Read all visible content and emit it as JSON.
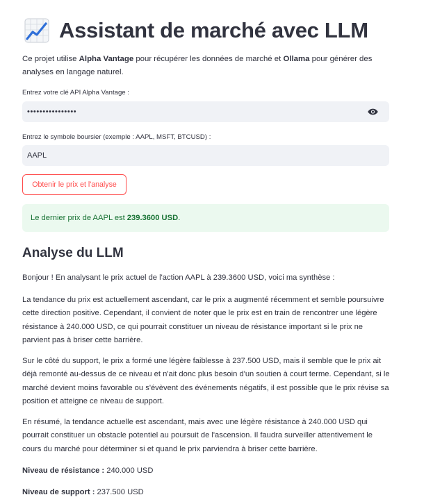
{
  "header": {
    "title": "Assistant de marché avec LLM",
    "icon": "chart-increasing-icon"
  },
  "intro": {
    "part1": "Ce projet utilise ",
    "bold1": "Alpha Vantage",
    "part2": " pour récupérer les données de marché et ",
    "bold2": "Ollama",
    "part3": " pour générer des analyses en langage naturel."
  },
  "api_key": {
    "label": "Entrez votre clé API Alpha Vantage :",
    "masked_value": "••••••••••••••••"
  },
  "symbol": {
    "label": "Entrez le symbole boursier (exemple : AAPL, MSFT, BTCUSD) :",
    "value": "AAPL"
  },
  "button": {
    "label": "Obtenir le prix et l'analyse",
    "color": "#ff4b4b"
  },
  "success": {
    "prefix": "Le dernier prix de AAPL est ",
    "price": "239.3600 USD",
    "suffix": ".",
    "color": "#177233",
    "background": "#ebf9ef"
  },
  "analysis": {
    "heading": "Analyse du LLM",
    "paragraphs": [
      "Bonjour ! En analysant le prix actuel de l'action AAPL à 239.3600 USD, voici ma synthèse :",
      "La tendance du prix est actuellement ascendant, car le prix a augmenté récemment et semble poursuivre cette direction positive. Cependant, il convient de noter que le prix est en train de rencontrer une légère résistance à 240.000 USD, ce qui pourrait constituer un niveau de résistance important si le prix ne parvient pas à briser cette barrière.",
      "Sur le côté du support, le prix a formé une légère faiblesse à 237.500 USD, mais il semble que le prix ait déjà remonté au-dessus de ce niveau et n'ait donc plus besoin d'un soutien à court terme. Cependant, si le marché devient moins favorable ou s'évèvent des événements négatifs, il est possible que le prix révise sa position et atteigne ce niveau de support.",
      "En résumé, la tendance actuelle est ascendant, mais avec une légère résistance à 240.000 USD qui pourrait constituer un obstacle potentiel au poursuit de l'ascension. Il faudra surveiller attentivement le cours du marché pour déterminer si et quand le prix parviendra à briser cette barrière."
    ],
    "resistance_label": "Niveau de résistance :",
    "resistance_value": " 240.000 USD",
    "support_label": "Niveau de support :",
    "support_value": " 237.500 USD"
  }
}
